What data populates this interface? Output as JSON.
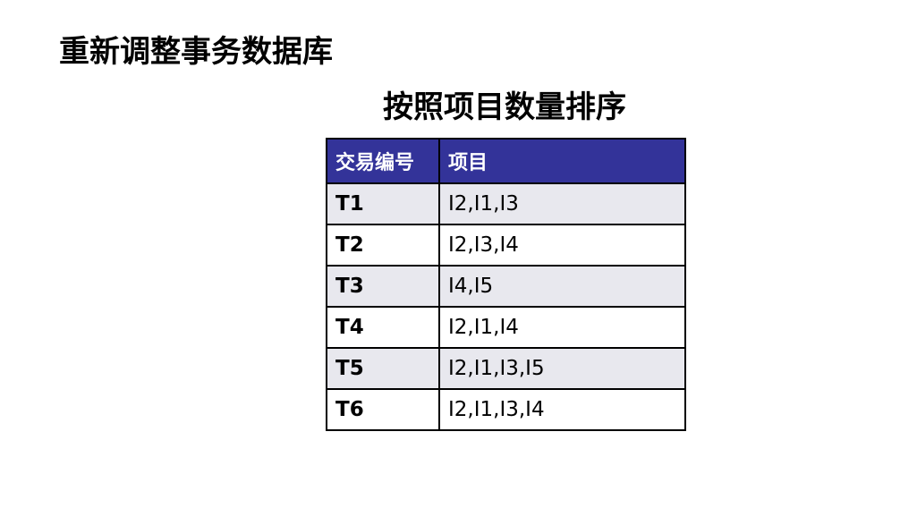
{
  "slide": {
    "title": "重新调整事务数据库",
    "subtitle": "按照项目数量排序"
  },
  "table": {
    "header_color": "#333399",
    "columns": [
      "交易编号",
      "项目"
    ],
    "rows": [
      [
        "T1",
        "I2,I1,I3"
      ],
      [
        "T2",
        "I2,I3,I4"
      ],
      [
        "T3",
        "I4,I5"
      ],
      [
        "T4",
        "I2,I1,I4"
      ],
      [
        "T5",
        "I2,I1,I3,I5"
      ],
      [
        "T6",
        "I2,I1,I3,I4"
      ]
    ]
  }
}
